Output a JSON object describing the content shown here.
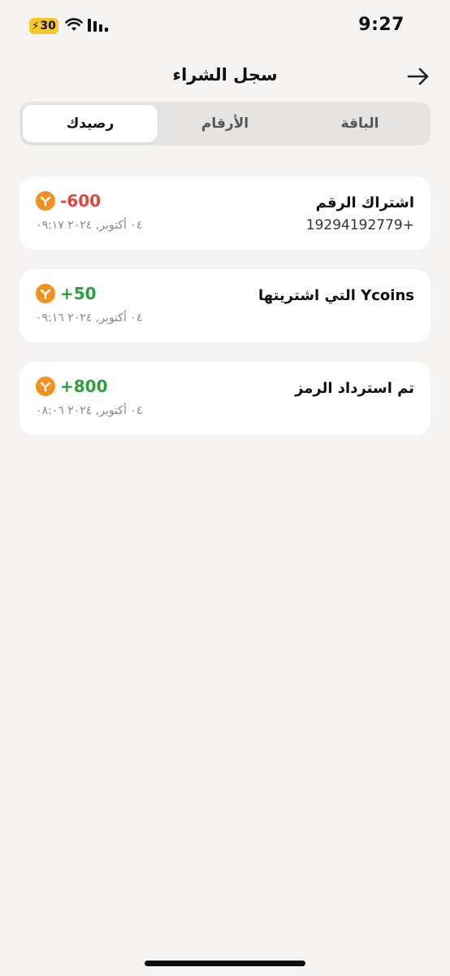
{
  "status_bar": {
    "time": "9:27",
    "battery_level": "30",
    "battery_color": "#f7c928"
  },
  "header": {
    "title": "سجل الشراء",
    "back_icon": "arrow-right-icon"
  },
  "tabs": [
    {
      "label": "الباقة",
      "active": false
    },
    {
      "label": "الأرقام",
      "active": false
    },
    {
      "label": "رصيدك",
      "active": true
    }
  ],
  "transactions": [
    {
      "title": "اشتراك الرقم",
      "subtitle": "19294192779+",
      "amount": "-600",
      "amount_type": "negative",
      "date": "٠٤ أكتوبر, ٢٠٢٤ ٠٩:١٧"
    },
    {
      "title": "Ycoins التي اشتريتها",
      "subtitle": "",
      "amount": "+50",
      "amount_type": "positive",
      "date": "٠٤ أكتوبر, ٢٠٢٤ ٠٩:١٦"
    },
    {
      "title": "تم استرداد الرمز",
      "subtitle": "",
      "amount": "+800",
      "amount_type": "positive",
      "date": "٠٤ أكتوبر, ٢٠٢٤ ٠٨:٠٦"
    }
  ],
  "colors": {
    "negative": "#e0463f",
    "positive": "#2a9f3a",
    "coin": "#f3911f",
    "background": "#f4f3f2"
  },
  "coin_icon": "ycoin-icon"
}
